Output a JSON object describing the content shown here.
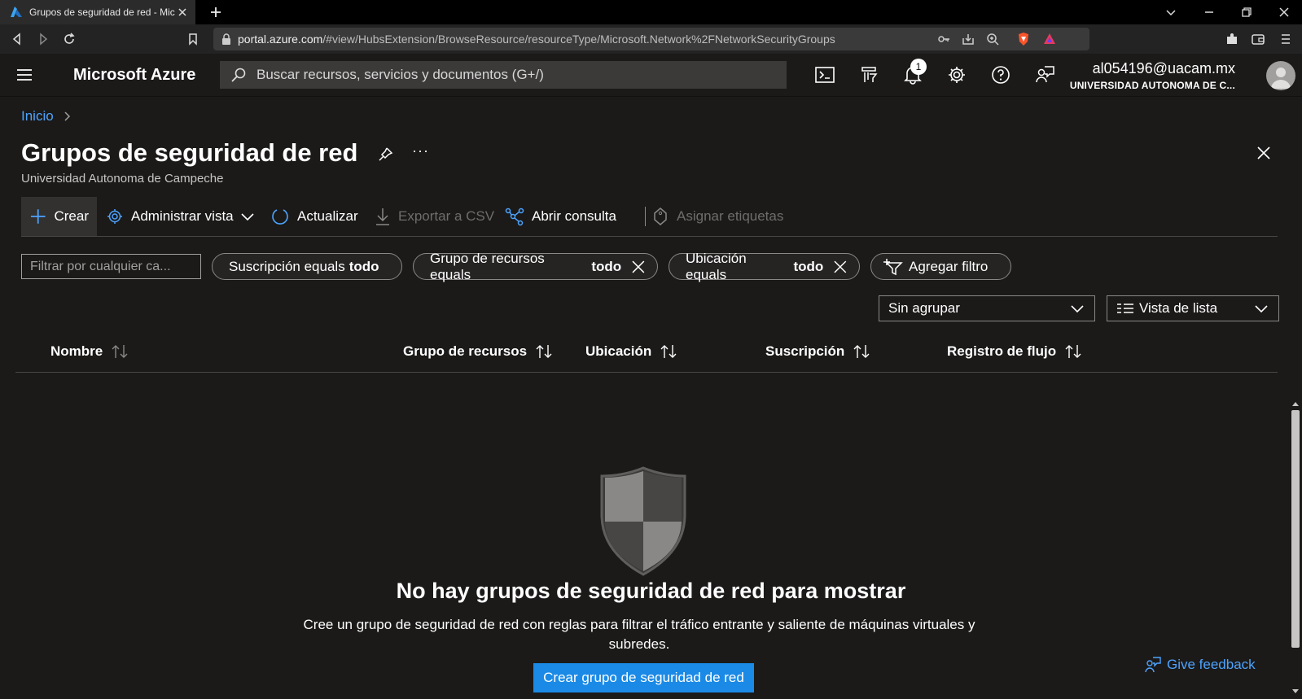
{
  "browser": {
    "tab_title": "Grupos de seguridad de red - Mic",
    "url_host": "portal.azure.com",
    "url_path": "/#view/HubsExtension/BrowseResource/resourceType/Microsoft.Network%2FNetworkSecurityGroups"
  },
  "topbar": {
    "brand": "Microsoft Azure",
    "search_placeholder": "Buscar recursos, servicios y documentos (G+/)",
    "notification_count": "1",
    "account_email": "al054196@uacam.mx",
    "account_tenant": "UNIVERSIDAD AUTONOMA DE C..."
  },
  "breadcrumb": {
    "home": "Inicio"
  },
  "page": {
    "title": "Grupos de seguridad de red",
    "subtitle": "Universidad Autonoma de Campeche",
    "more": "···"
  },
  "commands": {
    "create": "Crear",
    "manage_view": "Administrar vista",
    "refresh": "Actualizar",
    "export_csv": "Exportar a CSV",
    "open_query": "Abrir consulta",
    "assign_tags": "Asignar etiquetas"
  },
  "filters": {
    "placeholder": "Filtrar por cualquier ca...",
    "pills": [
      {
        "label": "Suscripción equals",
        "value": "todo"
      },
      {
        "label": "Grupo de recursos equals",
        "value": "todo"
      },
      {
        "label": "Ubicación equals",
        "value": "todo"
      }
    ],
    "add_filter": "Agregar filtro"
  },
  "view": {
    "grouping": "Sin agrupar",
    "list_view": "Vista de lista"
  },
  "columns": [
    "Nombre",
    "Grupo de recursos",
    "Ubicación",
    "Suscripción",
    "Registro de flujo"
  ],
  "empty_state": {
    "title": "No hay grupos de seguridad de red para mostrar",
    "description": "Cree un grupo de seguridad de red con reglas para filtrar el tráfico entrante y saliente de máquinas virtuales y subredes.",
    "button": "Crear grupo de seguridad de red"
  },
  "feedback": "Give feedback",
  "colors": {
    "accent": "#1a8ae6",
    "link": "#4da3ff",
    "background": "#1b1a19"
  }
}
